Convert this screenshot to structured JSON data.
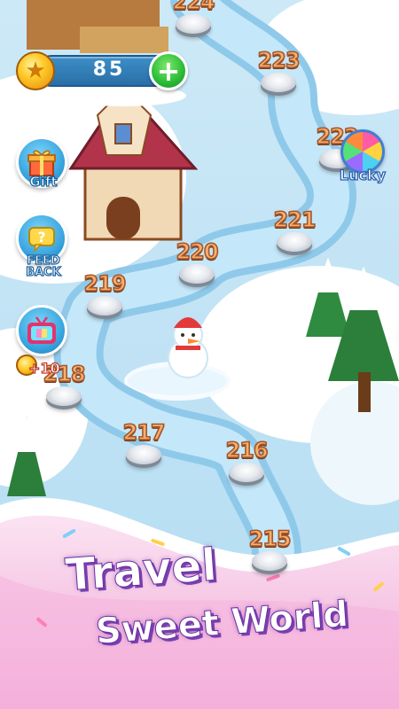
{
  "currency": {
    "coins": "85",
    "add_symbol": "+",
    "coin_icon": "star-coin-icon"
  },
  "side_buttons": {
    "gift": {
      "label": "Gift",
      "icon": "gift-box-icon"
    },
    "feedback": {
      "label": "FEED\nBACK",
      "icon": "feedback-question-icon"
    },
    "tv": {
      "icon": "tv-video-icon",
      "bonus": "+10"
    }
  },
  "lucky": {
    "label": "Lucky",
    "icon": "lucky-wheel-icon"
  },
  "levels": [
    "224",
    "223",
    "222",
    "221",
    "220",
    "219",
    "218",
    "217",
    "216",
    "215"
  ],
  "banner": {
    "line1": "Travel",
    "line2": "Sweet World"
  },
  "colors": {
    "path": "#bfe3f7",
    "snow": "#ffffff",
    "banner_pink": "#f6c3e3",
    "title_outline": "#7a3fb0"
  }
}
